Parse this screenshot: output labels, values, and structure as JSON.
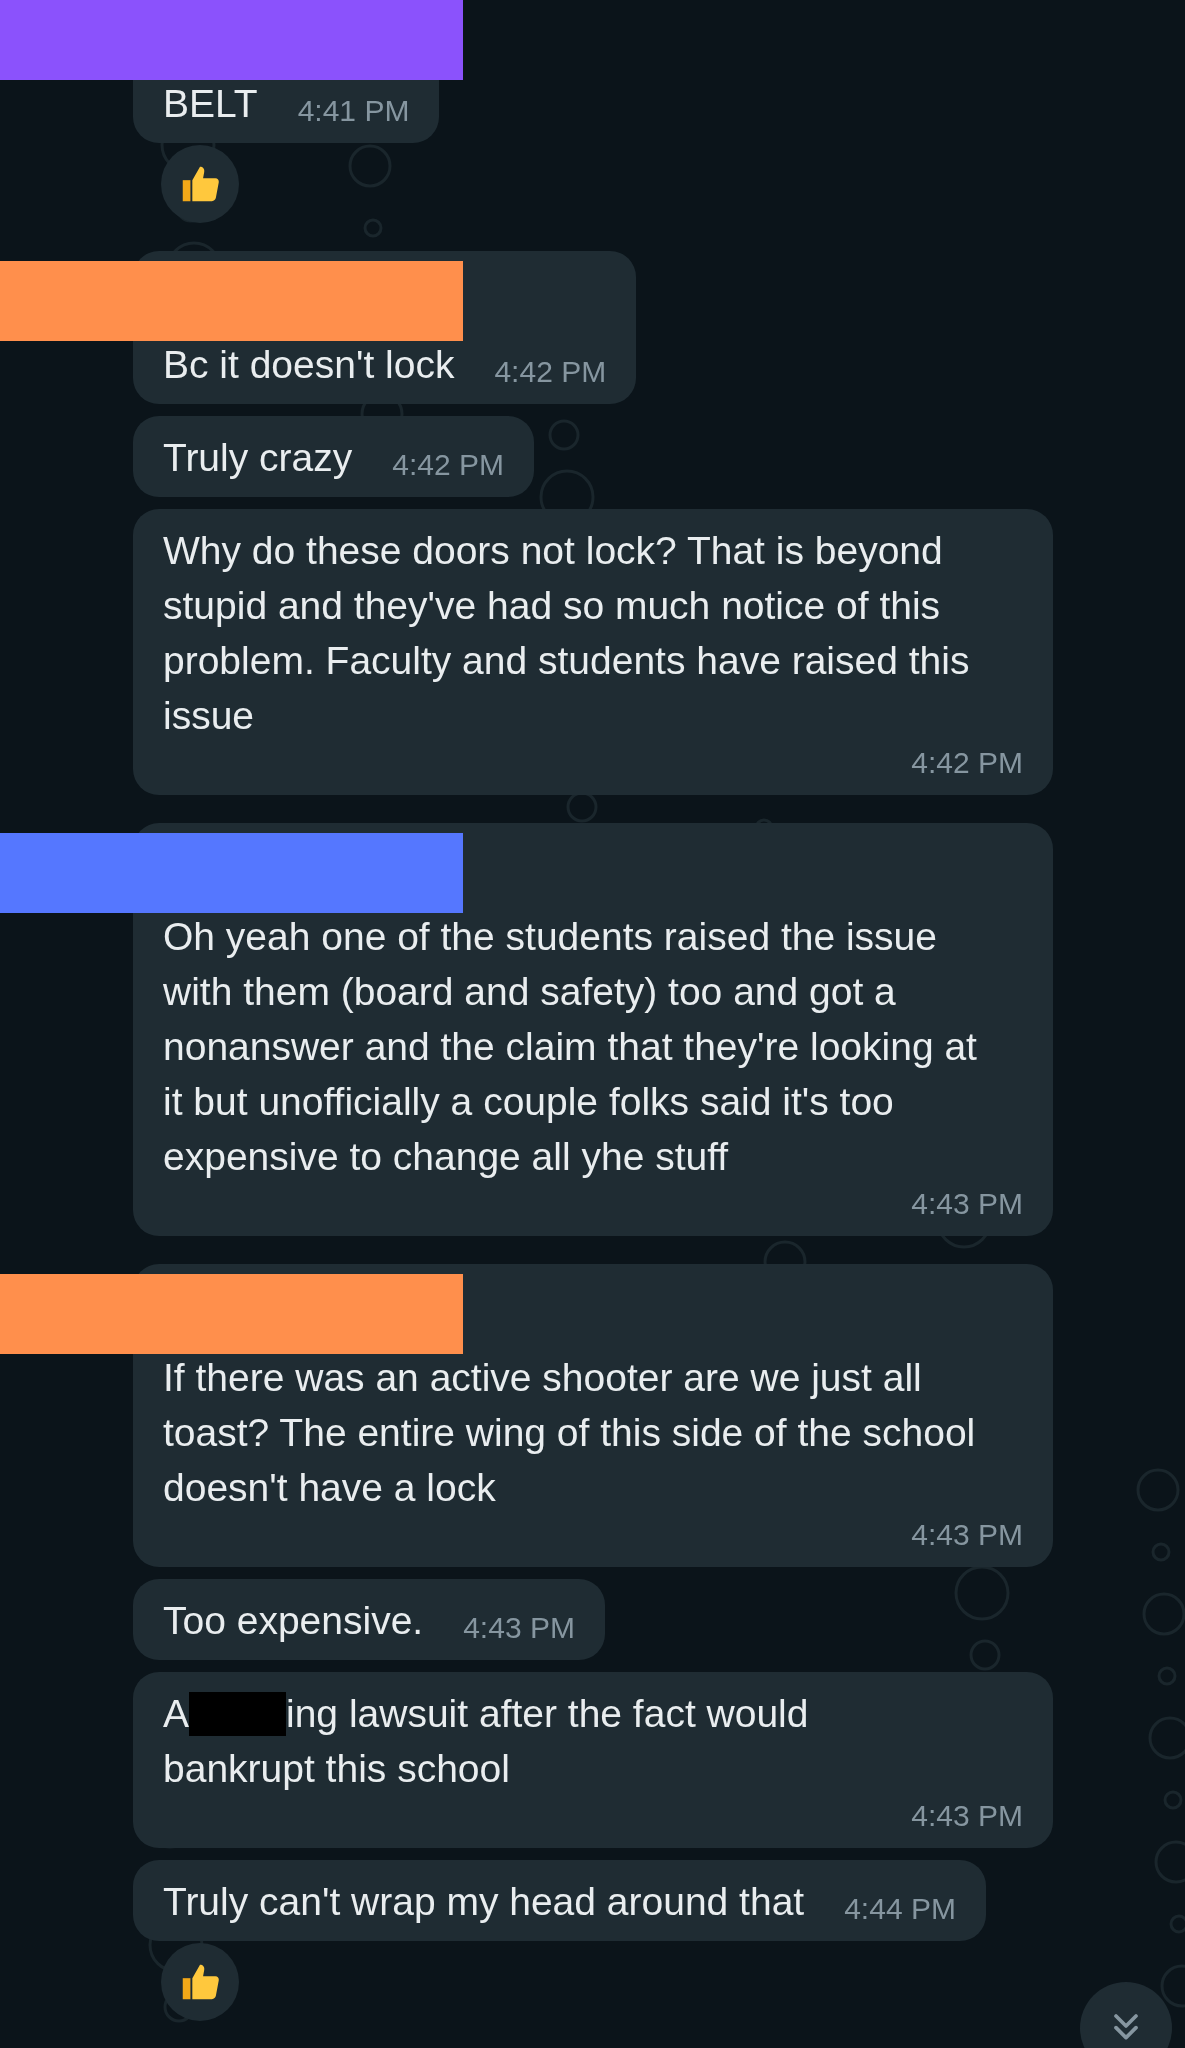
{
  "messages": [
    {
      "color": "#8b52fc",
      "segments": [
        {
          "kind": "text",
          "text": "BELT"
        }
      ],
      "time": "4:41 PM",
      "reacted": true
    },
    {
      "color": "#ff8f4c",
      "segments": [
        {
          "kind": "text",
          "text": "Bc it doesn't lock"
        }
      ],
      "time": "4:42 PM",
      "reacted": false
    },
    {
      "segments": [
        {
          "kind": "text",
          "text": "Truly crazy"
        }
      ],
      "time": "4:42 PM",
      "reacted": false
    },
    {
      "segments": [
        {
          "kind": "text",
          "text": "Why do these doors not lock? That is beyond stupid and they've had so much notice of this problem. Faculty and students have raised this issue"
        }
      ],
      "time": "4:42 PM",
      "reacted": false
    },
    {
      "color": "#5577ff",
      "segments": [
        {
          "kind": "text",
          "text": "Oh yeah one of the students raised the issue with them (board and safety) too and got a nonanswer and the claim that they're looking at it but unofficially a couple folks said it's too expensive to change all yhe stuff"
        }
      ],
      "time": "4:43 PM",
      "reacted": false
    },
    {
      "color": "#ff8f4c",
      "segments": [
        {
          "kind": "text",
          "text": "If there was an active shooter are we just all toast? The entire wing of this side of the school doesn't have a lock"
        }
      ],
      "time": "4:43 PM",
      "reacted": false
    },
    {
      "segments": [
        {
          "kind": "text",
          "text": "Too expensive."
        }
      ],
      "time": "4:43 PM",
      "reacted": false
    },
    {
      "segments": [
        {
          "kind": "text",
          "text": "A"
        },
        {
          "kind": "redaction"
        },
        {
          "kind": "text",
          "text": "ing lawsuit after the fact would"
        },
        {
          "kind": "newline"
        },
        {
          "kind": "text",
          "text": "bankrupt this school"
        }
      ],
      "time": "4:43 PM",
      "reacted": false
    },
    {
      "segments": [
        {
          "kind": "text",
          "text": "Truly can't wrap my head around that"
        }
      ],
      "time": "4:44 PM",
      "reacted": true
    }
  ],
  "scroll_down_button": true
}
